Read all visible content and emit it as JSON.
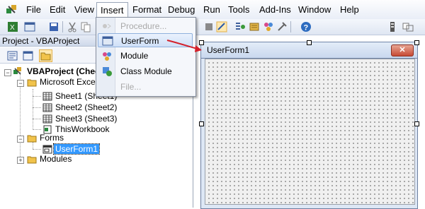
{
  "menubar": {
    "items": [
      "File",
      "Edit",
      "View",
      "Insert",
      "Format",
      "Debug",
      "Run",
      "Tools",
      "Add-Ins",
      "Window",
      "Help"
    ],
    "active": "Insert"
  },
  "insert_menu": {
    "items": [
      {
        "label": "Procedure...",
        "icon": "procedure-icon",
        "enabled": false
      },
      {
        "label": "UserForm",
        "icon": "userform-icon",
        "enabled": true,
        "highlighted": true
      },
      {
        "label": "Module",
        "icon": "module-icon",
        "enabled": true
      },
      {
        "label": "Class Module",
        "icon": "class-module-icon",
        "enabled": true
      },
      {
        "label": "File...",
        "icon": "",
        "enabled": false
      }
    ]
  },
  "project": {
    "title": "Project - VBAProject",
    "tree": {
      "root": "VBAProject (Chec",
      "excel_folder": "Microsoft Excel O",
      "sheets": [
        "Sheet1 (Sheet1)",
        "Sheet2 (Sheet2)",
        "Sheet3 (Sheet3)"
      ],
      "workbook": "ThisWorkbook",
      "forms_folder": "Forms",
      "selected_form": "UserForm1",
      "modules_folder": "Modules"
    }
  },
  "designer": {
    "form_title": "UserForm1",
    "close_glyph": "✕"
  },
  "colors": {
    "accent_arrow": "#d4202a",
    "selection": "#3399ff",
    "menu_highlight": "#cfe0f7"
  }
}
